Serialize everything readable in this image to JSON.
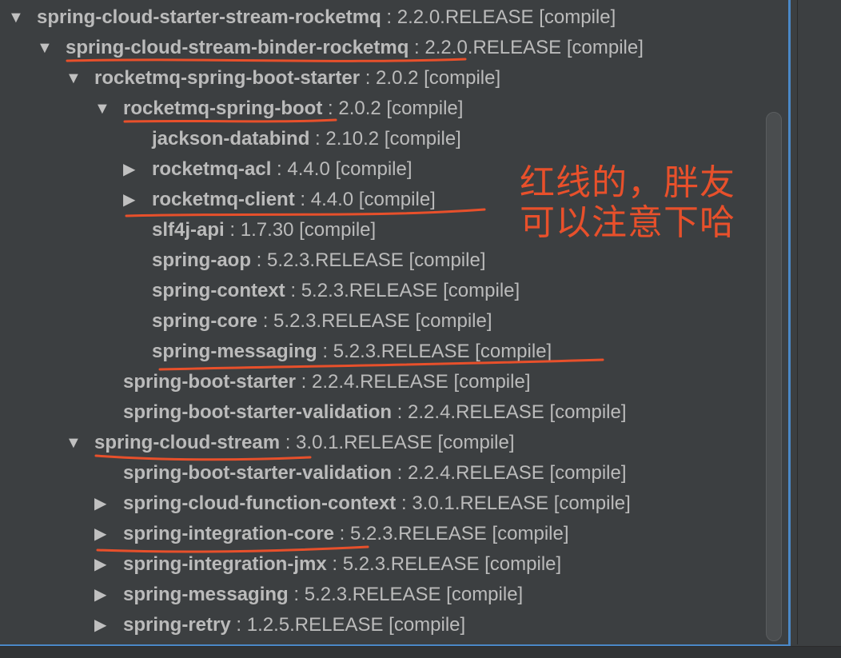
{
  "tree": [
    {
      "name": "spring-cloud-starter-stream-rocketmq",
      "version": "2.2.0.RELEASE",
      "scope": "[compile]",
      "depth": 0,
      "arrow": "expanded"
    },
    {
      "name": "spring-cloud-stream-binder-rocketmq",
      "version": "2.2.0.RELEASE",
      "scope": "[compile]",
      "depth": 1,
      "arrow": "expanded"
    },
    {
      "name": "rocketmq-spring-boot-starter",
      "version": "2.0.2",
      "scope": "[compile]",
      "depth": 2,
      "arrow": "expanded"
    },
    {
      "name": "rocketmq-spring-boot",
      "version": "2.0.2",
      "scope": "[compile]",
      "depth": 3,
      "arrow": "expanded"
    },
    {
      "name": "jackson-databind",
      "version": "2.10.2",
      "scope": "[compile]",
      "depth": 4,
      "arrow": "none"
    },
    {
      "name": "rocketmq-acl",
      "version": "4.4.0",
      "scope": "[compile]",
      "depth": 4,
      "arrow": "collapsed"
    },
    {
      "name": "rocketmq-client",
      "version": "4.4.0",
      "scope": "[compile]",
      "depth": 4,
      "arrow": "collapsed"
    },
    {
      "name": "slf4j-api",
      "version": "1.7.30",
      "scope": "[compile]",
      "depth": 4,
      "arrow": "none"
    },
    {
      "name": "spring-aop",
      "version": "5.2.3.RELEASE",
      "scope": "[compile]",
      "depth": 4,
      "arrow": "none"
    },
    {
      "name": "spring-context",
      "version": "5.2.3.RELEASE",
      "scope": "[compile]",
      "depth": 4,
      "arrow": "none"
    },
    {
      "name": "spring-core",
      "version": "5.2.3.RELEASE",
      "scope": "[compile]",
      "depth": 4,
      "arrow": "none"
    },
    {
      "name": "spring-messaging",
      "version": "5.2.3.RELEASE",
      "scope": "[compile]",
      "depth": 4,
      "arrow": "none"
    },
    {
      "name": "spring-boot-starter",
      "version": "2.2.4.RELEASE",
      "scope": "[compile]",
      "depth": 3,
      "arrow": "none"
    },
    {
      "name": "spring-boot-starter-validation",
      "version": "2.2.4.RELEASE",
      "scope": "[compile]",
      "depth": 3,
      "arrow": "none"
    },
    {
      "name": "spring-cloud-stream",
      "version": "3.0.1.RELEASE",
      "scope": "[compile]",
      "depth": 2,
      "arrow": "expanded"
    },
    {
      "name": "spring-boot-starter-validation",
      "version": "2.2.4.RELEASE",
      "scope": "[compile]",
      "depth": 3,
      "arrow": "none"
    },
    {
      "name": "spring-cloud-function-context",
      "version": "3.0.1.RELEASE",
      "scope": "[compile]",
      "depth": 3,
      "arrow": "collapsed"
    },
    {
      "name": "spring-integration-core",
      "version": "5.2.3.RELEASE",
      "scope": "[compile]",
      "depth": 3,
      "arrow": "collapsed"
    },
    {
      "name": "spring-integration-jmx",
      "version": "5.2.3.RELEASE",
      "scope": "[compile]",
      "depth": 3,
      "arrow": "collapsed"
    },
    {
      "name": "spring-messaging",
      "version": "5.2.3.RELEASE",
      "scope": "[compile]",
      "depth": 3,
      "arrow": "collapsed"
    },
    {
      "name": "spring-retry",
      "version": "1.2.5.RELEASE",
      "scope": "[compile]",
      "depth": 3,
      "arrow": "collapsed"
    }
  ],
  "annotation": {
    "line1": "红线的，胖友",
    "line2": "可以注意下哈",
    "color": "#e8502b"
  },
  "colors": {
    "background": "#3c3f41",
    "text": "#bbbbbb",
    "focus_border": "#4a88c7",
    "underline": "#e8502b"
  }
}
